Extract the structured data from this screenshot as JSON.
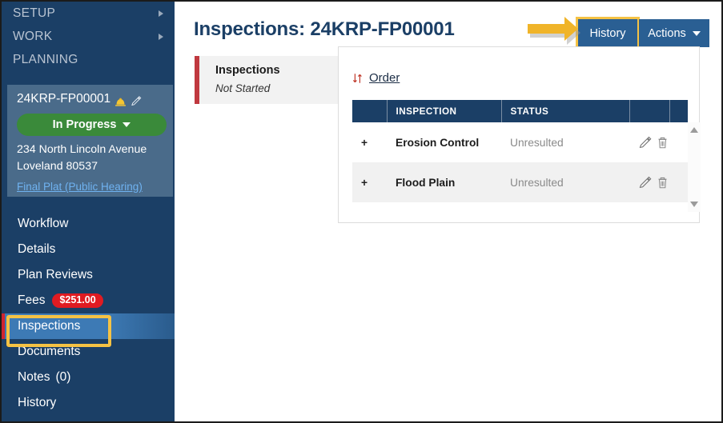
{
  "sidebar": {
    "groups": [
      {
        "label": "SETUP",
        "has_caret": true
      },
      {
        "label": "WORK",
        "has_caret": true
      },
      {
        "label": "PLANNING",
        "has_caret": false
      }
    ],
    "record": {
      "id": "24KRP-FP00001",
      "hardhat_icon": "hardhat-icon",
      "edit_icon": "pencil-icon",
      "status_label": "In Progress",
      "status_color": "#3a8a3a",
      "address_line1": "234 North Lincoln Avenue",
      "address_line2": "Loveland 80537",
      "record_type_link": "Final Plat (Public Hearing)"
    },
    "items": [
      {
        "label": "Workflow",
        "badge": null,
        "count": null,
        "active": false
      },
      {
        "label": "Details",
        "badge": null,
        "count": null,
        "active": false
      },
      {
        "label": "Plan Reviews",
        "badge": null,
        "count": null,
        "active": false
      },
      {
        "label": "Fees",
        "badge": "$251.00",
        "count": null,
        "active": false
      },
      {
        "label": "Inspections",
        "badge": null,
        "count": null,
        "active": true
      },
      {
        "label": "Documents",
        "badge": null,
        "count": null,
        "active": false
      },
      {
        "label": "Notes",
        "badge": null,
        "count": "(0)",
        "active": false
      },
      {
        "label": "History",
        "badge": null,
        "count": null,
        "active": false
      }
    ],
    "highlight_color": "#f5c244"
  },
  "header": {
    "title": "Inspections: 24KRP-FP00001",
    "history_button": "History",
    "actions_button": "Actions",
    "button_color": "#2a5f93",
    "annotation_arrow_color": "#f0b429"
  },
  "step": {
    "title": "Inspections",
    "status": "Not Started",
    "accent_color": "#c0393f"
  },
  "content": {
    "order_link": "Order",
    "order_icon": "sort-updown-icon",
    "table": {
      "columns": [
        "",
        "INSPECTION",
        "STATUS",
        "",
        ""
      ],
      "rows": [
        {
          "expand": "+",
          "inspection": "Erosion Control",
          "status": "Unresulted",
          "edit_icon": "pencil-icon",
          "delete_icon": "trash-icon"
        },
        {
          "expand": "+",
          "inspection": "Flood Plain",
          "status": "Unresulted",
          "edit_icon": "pencil-icon",
          "delete_icon": "trash-icon"
        }
      ]
    },
    "scrollbar": {
      "up_icon": "scroll-up-icon",
      "down_icon": "scroll-down-icon"
    }
  }
}
